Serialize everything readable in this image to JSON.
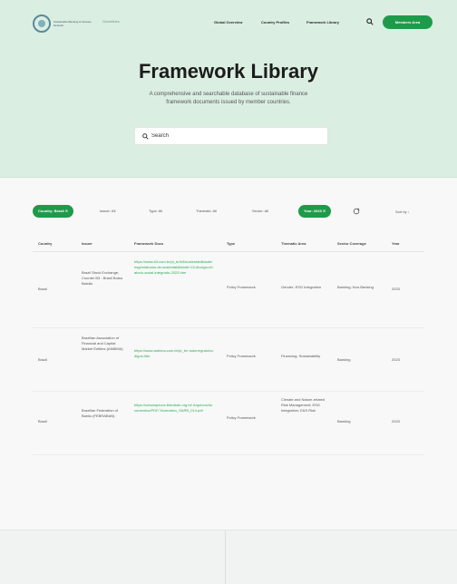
{
  "nav": {
    "logo_text": "Sustainable Banking & Finance Network",
    "logo_sub": "Guidelines",
    "links": [
      "Global Overview",
      "Country Profiles",
      "Framework Library"
    ],
    "member_button": "Members Area"
  },
  "hero": {
    "title": "Framework Library",
    "description": "A comprehensive and searchable database of sustainable finance framework documents issued by member countries.",
    "search_placeholder": "Search"
  },
  "filters": {
    "country": "Country: Brazil ✕",
    "issuer": "Issuer: All",
    "type": "Type: All",
    "thematic": "Thematic: All",
    "sector": "Sector: All",
    "year": "Year: 2023 ✕",
    "results": "Sort by ↓"
  },
  "table": {
    "headers": [
      "Country",
      "Issuer",
      "Framework Docs",
      "Type",
      "Thematic Area",
      "Sector Coverage",
      "Year"
    ],
    "rows": [
      {
        "country": "Brazil",
        "issuer": "Brazil Stock Exchange; Counter B3 - Brasil Bolsa Balcão",
        "docs": "https://www.b3.com.br/pt_br/b3/sustentabilidade/esg/relatorios-de-sustentabilidade/ b3-divulga-relatorio-anual-integrado-2023.htm",
        "type": "Policy Framework",
        "thematic": "Gender; ESG Integration",
        "sector": "Banking; Non-Banking",
        "year": "2023"
      },
      {
        "country": "Brazil",
        "issuer": "Brazilian Association of Financial and Capital Market Entities (ANBIMA)",
        "docs": "https://www.anbima.com.br/pt_br/ autorregular/codigos.htm",
        "type": "Policy Framework",
        "thematic": "Financing; Sustainability",
        "sector": "Banking",
        "year": "2023"
      },
      {
        "country": "Brazil",
        "issuer": "Brazilian Federation of Banks (FEBRABAN)",
        "docs": "https://cmsarquivos.febraban.org.br/ Arquivos/documentos/PDF/ Normativo_SARB_014.pdf",
        "type": "Policy Framework",
        "thematic": "Climate and Nature-related Risk Management; ESG Integration; E&S Risk",
        "sector": "Banking",
        "year": "2023"
      }
    ]
  }
}
